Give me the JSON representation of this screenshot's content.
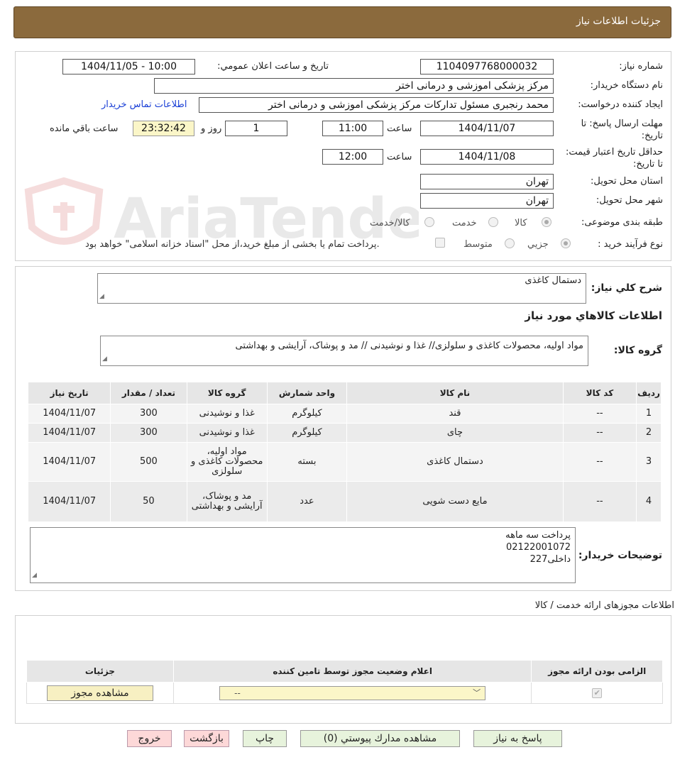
{
  "header": {
    "title": "جزئیات اطلاعات نیاز"
  },
  "form": {
    "need_number_label": "شماره نیاز:",
    "need_number": "1104097768000032",
    "announce_label": "تاریخ و ساعت اعلان عمومي:",
    "announce_value": "1404/11/05 - 10:00",
    "buyer_org_label": "نام دستگاه خریدار:",
    "buyer_org": "مرکز پزشکی  اموزشی و درمانی اختر",
    "creator_label": "ایجاد کننده درخواست:",
    "creator": "محمد رنجبری مسئول تدارکات مرکز پزشکی  اموزشی و درمانی اختر",
    "contact_link": "اطلاعات تماس خریدار",
    "deadline_label": "مهلت ارسال پاسخ: تا تاریخ:",
    "deadline_date": "1404/11/07",
    "time_label": "ساعت",
    "deadline_time": "11:00",
    "days_value": "1",
    "days_label": "روز و",
    "remaining_time": "23:32:42",
    "remaining_label": "ساعت باقي مانده",
    "validity_label": "حداقل تاریخ اعتبار قیمت: تا تاریخ:",
    "validity_date": "1404/11/08",
    "validity_time": "12:00",
    "province_label": "استان محل تحویل:",
    "province": "تهران",
    "city_label": "شهر محل تحویل:",
    "city": "تهران",
    "category_label": "طبقه بندی موضوعی:",
    "category_options": [
      "کالا",
      "خدمت",
      "کالا/خدمت"
    ],
    "process_label": "نوع فرآیند خرید :",
    "process_options": [
      "جزیي",
      "متوسط"
    ],
    "payment_note": "پرداخت تمام یا بخشی از مبلغ خرید،از محل \"اسناد خزانه اسلامی\" خواهد بود."
  },
  "watermark": {
    "text": "AriaTender.neT"
  },
  "summary": {
    "general_desc_label": "شرح کلي نیاز:",
    "general_desc": "دستمال کاغذی",
    "goods_info_title": "اطلاعات کالاهاي مورد نياز",
    "goods_group_label": "گروه کالا:",
    "goods_group": "مواد اولیه، محصولات کاغذی و سلولزی// غذا و نوشیدنی // مد و پوشاک، آرایشی و بهداشتی"
  },
  "goods_table": {
    "headers": [
      "ردیف",
      "کد کالا",
      "نام کالا",
      "واحد شمارش",
      "گروه کالا",
      "تعداد / مقدار",
      "تاریخ نیاز"
    ],
    "rows": [
      [
        "1",
        "--",
        "قند",
        "کیلوگرم",
        "غذا و نوشیدنی",
        "300",
        "1404/11/07"
      ],
      [
        "2",
        "--",
        "چای",
        "کیلوگرم",
        "غذا و نوشیدنی",
        "300",
        "1404/11/07"
      ],
      [
        "3",
        "--",
        "دستمال کاغذی",
        "بسته",
        "مواد اولیه، محصولات کاغذی و سلولزی",
        "500",
        "1404/11/07"
      ],
      [
        "4",
        "--",
        "مایع دست شویی",
        "عدد",
        "مد و پوشاک، آرایشی و بهداشتی",
        "50",
        "1404/11/07"
      ]
    ]
  },
  "buyer_notes": {
    "label": "توضیحات خریدار:",
    "lines": [
      "پرداخت سه ماهه",
      "02122001072",
      "داخلی227"
    ]
  },
  "license": {
    "title": "اطلاعات مجوزهای ارائه خدمت / کالا",
    "headers": [
      "الزامی بودن ارائه مجوز",
      "اعلام وضعیت مجوز توسط تامین کننده",
      "جزئیات"
    ],
    "select_value": "--",
    "view_button": "مشاهده مجوز"
  },
  "footer": {
    "reply": "پاسخ به نیاز",
    "attachments": "مشاهده مدارك پيوستي (0)",
    "print": "چاپ",
    "back": "بازگشت",
    "exit": "خروج"
  }
}
